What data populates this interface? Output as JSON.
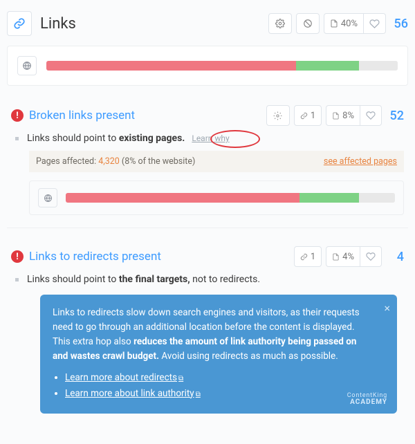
{
  "header": {
    "title": "Links",
    "stats_pct": "40%",
    "score": "56"
  },
  "overall_bar": {
    "red_pct": 71,
    "green_pct": 18,
    "grey_pct": 11
  },
  "issues": [
    {
      "title": "Broken links present",
      "sub_prefix": "Links should point to ",
      "sub_bold": "existing pages.",
      "sub_suffix": "",
      "learn_why": "Learn why",
      "chip_count": "1",
      "chip_pct": "8%",
      "score": "52",
      "affected_label": "Pages affected: ",
      "affected_count": "4,320",
      "affected_pct": "(8% of the website)",
      "affected_link": "see affected pages",
      "bar": {
        "red_pct": 71,
        "green_pct": 18,
        "grey_pct": 11
      }
    },
    {
      "title": "Links to redirects present",
      "sub_prefix": "Links should point to ",
      "sub_bold": "the final targets,",
      "sub_suffix": " not to redirects.",
      "chip_count": "1",
      "chip_pct": "4%",
      "score": "4"
    }
  ],
  "infobox": {
    "text_a": "Links to redirects slow down search engines and visitors, as their requests need to go through an additional location before the content is displayed. This extra hop also ",
    "text_bold": "reduces the amount of link authority being passed on and wastes crawl budget.",
    "text_b": " Avoid using redirects as much as possible.",
    "link1": "Learn more about redirects",
    "link2": "Learn more about link authority",
    "brand_a": "ContentKing",
    "brand_b": "ACADEMY"
  }
}
